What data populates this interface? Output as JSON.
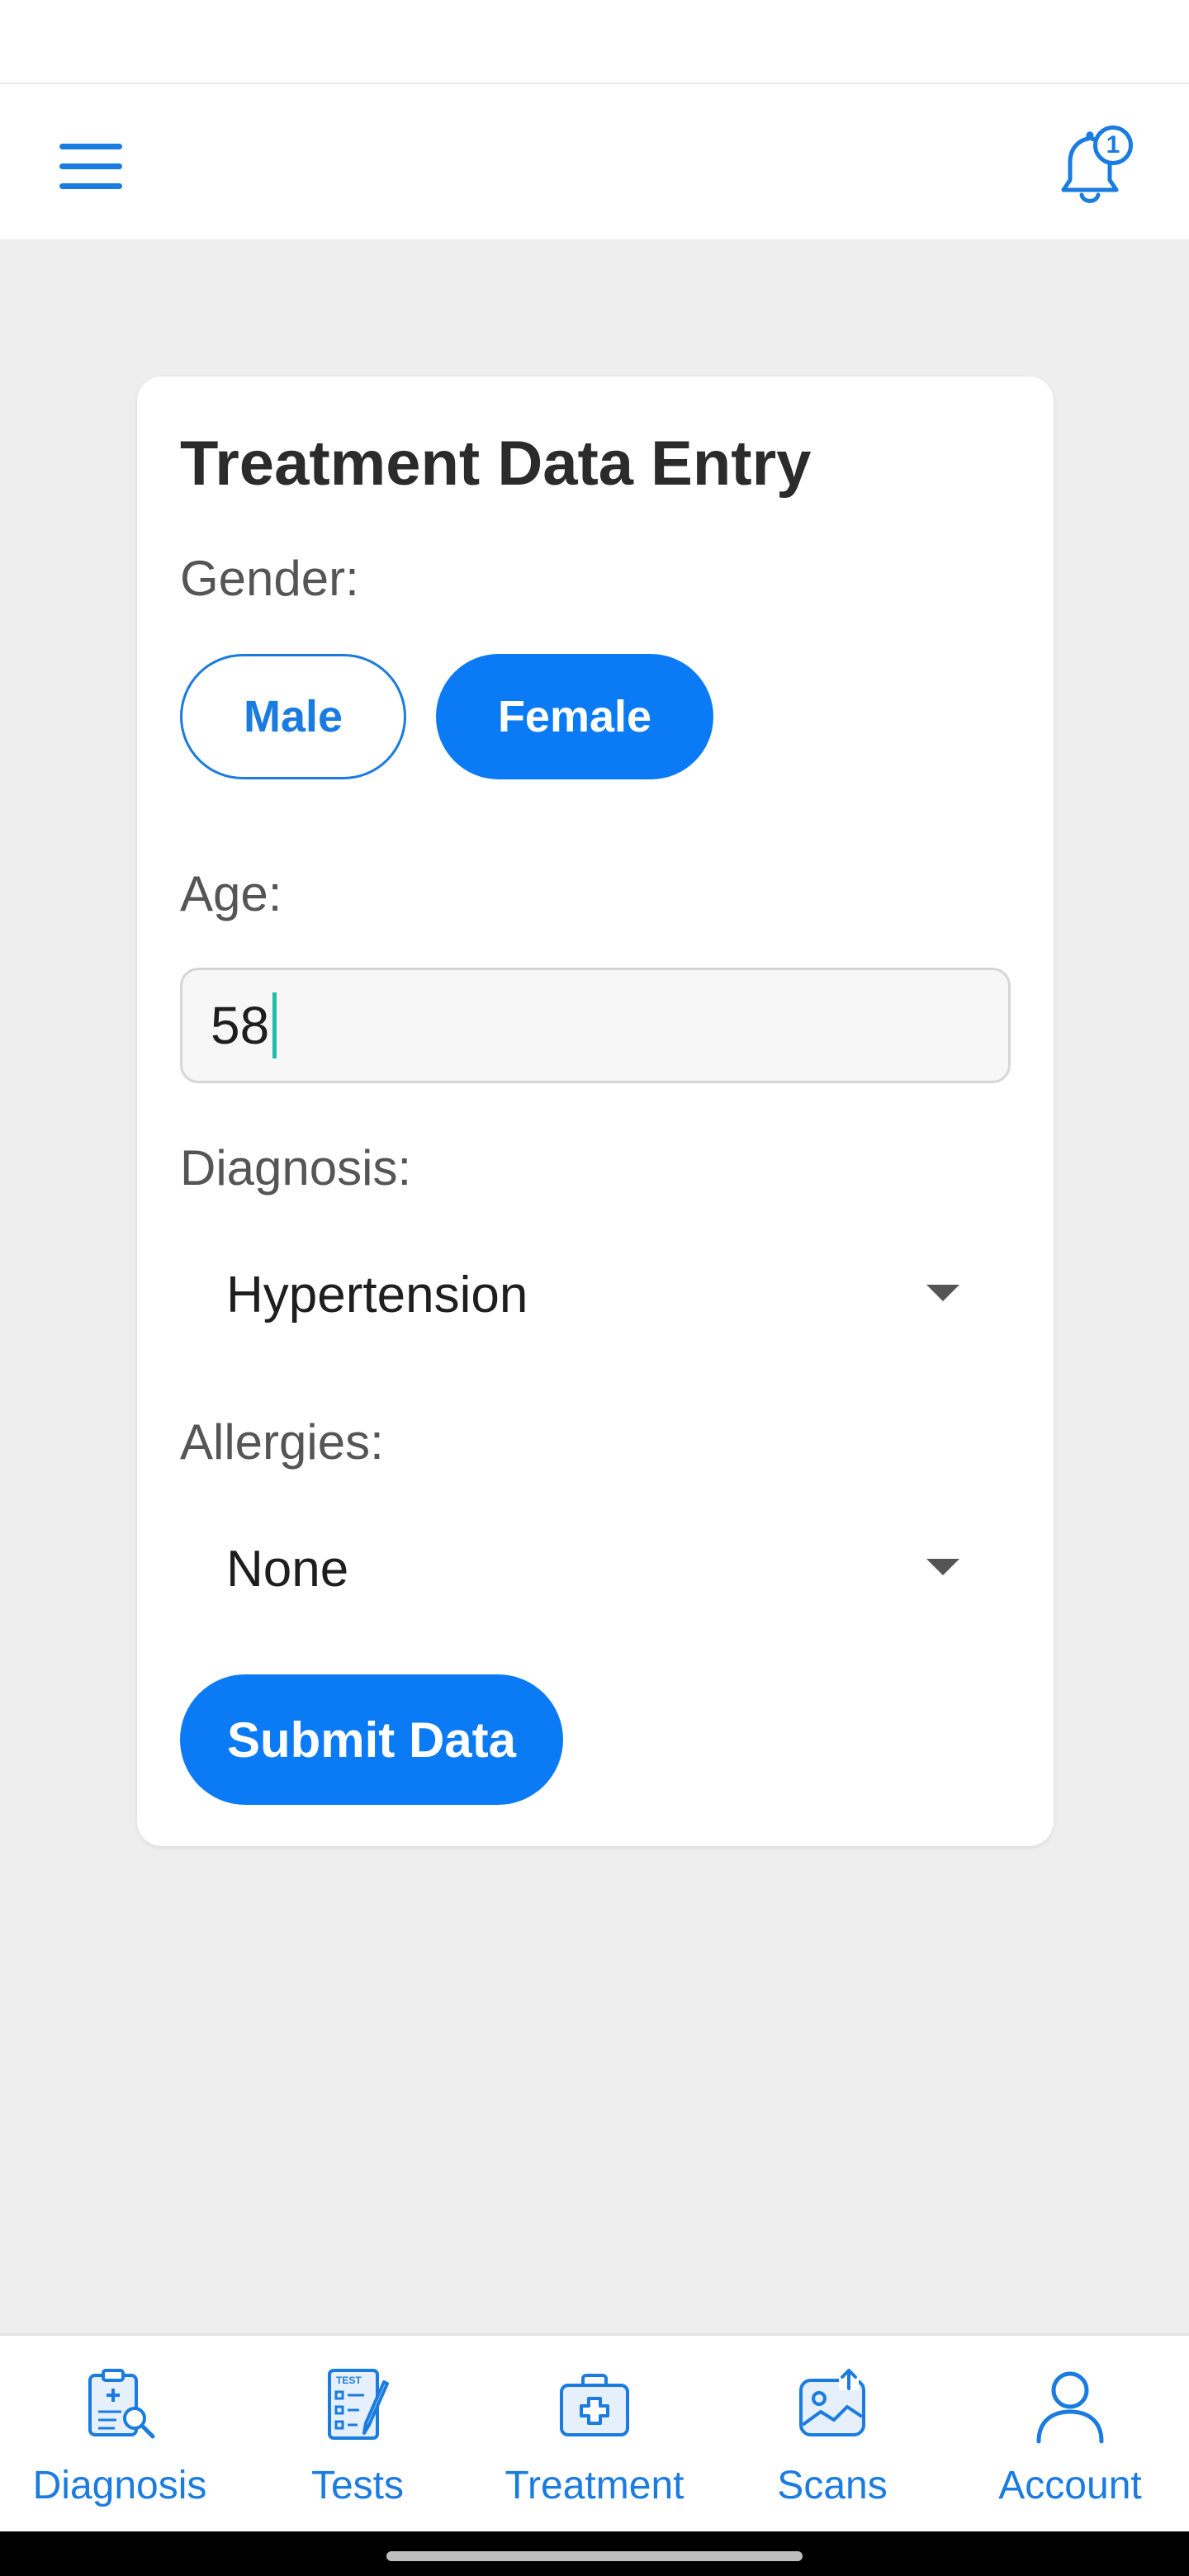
{
  "header": {
    "notification_count": "1",
    "menu_icon": "hamburger-menu-icon",
    "bell_icon": "bell-icon"
  },
  "form": {
    "title": "Treatment Data Entry",
    "gender_label": "Gender:",
    "gender_options": [
      "Male",
      "Female"
    ],
    "gender_selected": "Female",
    "age_label": "Age:",
    "age_value": "58",
    "diagnosis_label": "Diagnosis:",
    "diagnosis_value": "Hypertension",
    "allergies_label": "Allergies:",
    "allergies_value": "None",
    "submit_label": "Submit Data"
  },
  "bottom_nav": {
    "items": [
      {
        "label": "Diagnosis",
        "icon": "clipboard-search-icon"
      },
      {
        "label": "Tests",
        "icon": "test-sheet-icon"
      },
      {
        "label": "Treatment",
        "icon": "medical-kit-icon"
      },
      {
        "label": "Scans",
        "icon": "scan-image-icon"
      },
      {
        "label": "Account",
        "icon": "user-icon"
      }
    ]
  },
  "colors": {
    "accent": "#0a7bf5",
    "icon_blue": "#1a7be0",
    "background": "#eeeeee",
    "caret": "#1fbfa8"
  }
}
